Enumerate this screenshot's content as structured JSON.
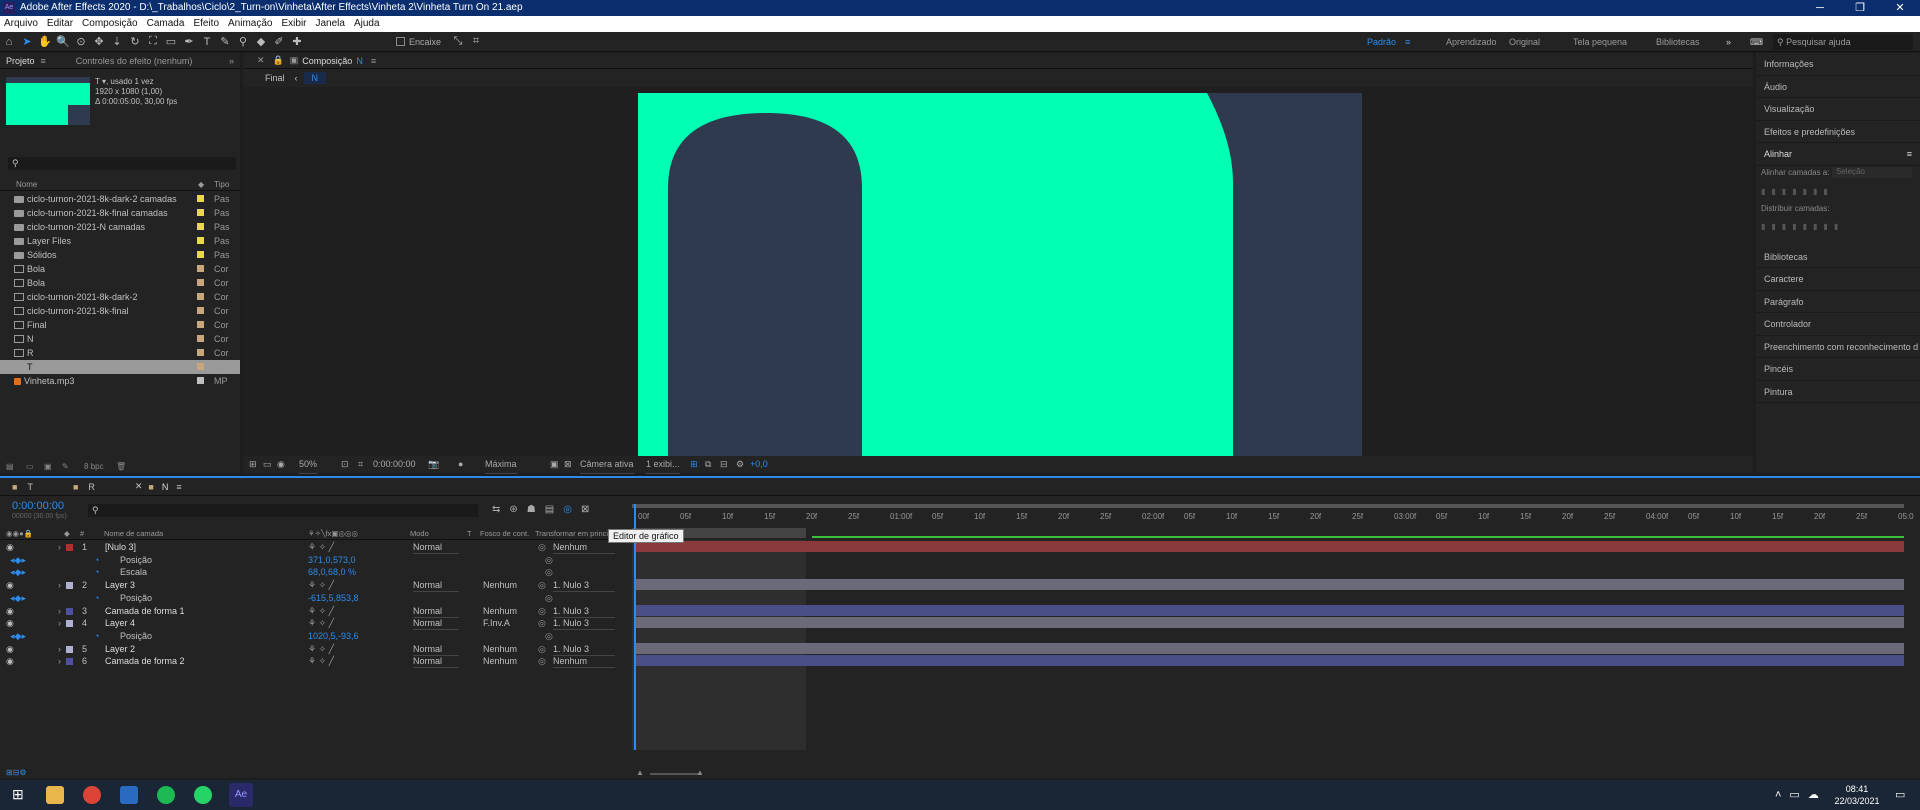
{
  "window": {
    "title": "Adobe After Effects 2020 - D:\\_Trabalhos\\Ciclo\\2_Turn-on\\Vinheta\\After Effects\\Vinheta 2\\Vinheta Turn On 21.aep",
    "app_badge": "Ae"
  },
  "menu": [
    "Arquivo",
    "Editar",
    "Composição",
    "Camada",
    "Efeito",
    "Animação",
    "Exibir",
    "Janela",
    "Ajuda"
  ],
  "toolbar": {
    "snap_label": "Encaixe",
    "search_placeholder": "Pesquisar ajuda"
  },
  "workspaces": [
    "Padrão",
    "Aprendizado",
    "Original",
    "Tela pequena",
    "Bibliotecas"
  ],
  "project": {
    "tab_project": "Projeto",
    "tab_effects": "Controles do efeito (nenhum)",
    "selected_name": "T ▾, usado 1 vez",
    "selected_dims": "1920 x 1080 (1,00)",
    "selected_duration": "Δ 0:00:05:00, 30,00 fps",
    "col_name": "Nome",
    "col_type": "Tipo",
    "bpc": "8 bpc",
    "items": [
      {
        "name": "ciclo-turnon-2021-8k-dark-2 camadas",
        "kind": "folder",
        "color": "#e8d84a",
        "type": "Pas"
      },
      {
        "name": "ciclo-turnon-2021-8k-final camadas",
        "kind": "folder",
        "color": "#e8d84a",
        "type": "Pas"
      },
      {
        "name": "ciclo-turnon-2021-N camadas",
        "kind": "folder",
        "color": "#e8d84a",
        "type": "Pas"
      },
      {
        "name": "Layer Files",
        "kind": "folder",
        "color": "#e8d84a",
        "type": "Pas"
      },
      {
        "name": "Sólidos",
        "kind": "folder",
        "color": "#e8d84a",
        "type": "Pas"
      },
      {
        "name": "Bola",
        "kind": "comp",
        "color": "#c8a87a",
        "type": "Cor"
      },
      {
        "name": "Bola",
        "kind": "comp",
        "color": "#c8a87a",
        "type": "Cor"
      },
      {
        "name": "ciclo-turnon-2021-8k-dark-2",
        "kind": "comp",
        "color": "#c8a87a",
        "type": "Cor"
      },
      {
        "name": "ciclo-turnon-2021-8k-final",
        "kind": "comp",
        "color": "#c8a87a",
        "type": "Cor"
      },
      {
        "name": "Final",
        "kind": "comp",
        "color": "#c8a87a",
        "type": "Cor"
      },
      {
        "name": "N",
        "kind": "comp",
        "color": "#c8a87a",
        "type": "Cor"
      },
      {
        "name": "R",
        "kind": "comp",
        "color": "#c8a87a",
        "type": "Cor"
      },
      {
        "name": "T",
        "kind": "comp",
        "color": "#c8a87a",
        "type": "Cor",
        "selected": true
      },
      {
        "name": "Vinheta.mp3",
        "kind": "audio",
        "color": "#bfbfbf",
        "type": "MP"
      }
    ]
  },
  "composition": {
    "tab_label": "Composição",
    "tab_name": "N",
    "breadcrumb_root": "Final",
    "breadcrumb_current": "N",
    "zoom": "50%",
    "timecode": "0:00:00:00",
    "quality": "Máxima",
    "camera": "Câmera ativa",
    "views": "1 exibi...",
    "exposure": "+0,0",
    "colors": {
      "bg": "#2f3a4f",
      "accent": "#00ffb3"
    }
  },
  "right_panel": [
    "Informações",
    "Áudio",
    "Visualização",
    "Efeitos e predefinições",
    "Alinhar",
    "Bibliotecas",
    "Caractere",
    "Parágrafo",
    "Controlador",
    "Preenchimento com reconhecimento d",
    "Pincéis",
    "Pintura"
  ],
  "align": {
    "align_to_label": "Alinhar camadas a:",
    "align_to_value": "Seleção",
    "distribute_label": "Distribuir camadas:"
  },
  "timeline": {
    "tabs": [
      "T",
      "R",
      "N"
    ],
    "timecode": "0:00:00:00",
    "fps": "00000 (30.00 fps)",
    "tooltip": "Editor de gráfico",
    "headers": {
      "name": "Nome de camada",
      "mode": "Modo",
      "t": "T",
      "matte": "Fosco de cont.",
      "parent": "Transformar em principal"
    },
    "ruler": [
      "00f",
      "05f",
      "10f",
      "15f",
      "20f",
      "25f",
      "01:00f",
      "05f",
      "10f",
      "15f",
      "20f",
      "25f",
      "02:00f",
      "05f",
      "10f",
      "15f",
      "20f",
      "25f",
      "03:00f",
      "05f",
      "10f",
      "15f",
      "20f",
      "25f",
      "04:00f",
      "05f",
      "10f",
      "15f",
      "20f",
      "25f",
      "05:0"
    ],
    "layers": [
      {
        "num": "1",
        "name": "[Nulo 3]",
        "color": "#b03030",
        "mode": "Normal",
        "matte": "",
        "parent": "Nenhum",
        "bar": "#8a3a3a"
      },
      {
        "prop": "Posição",
        "value": "371,0,573,0"
      },
      {
        "prop": "Escala",
        "value": "68,0,68,0 %"
      },
      {
        "num": "2",
        "name": "Layer 3",
        "color": "#b0b0d0",
        "mode": "Normal",
        "matte": "Nenhum",
        "parent": "1. Nulo 3",
        "bar": "#6a6a78"
      },
      {
        "prop": "Posição",
        "value": "-615,5,853,8"
      },
      {
        "num": "3",
        "name": "Camada de forma 1",
        "color": "#5050a0",
        "mode": "Normal",
        "matte": "Nenhum",
        "parent": "1. Nulo 3",
        "bar": "#4a4f88"
      },
      {
        "num": "4",
        "name": "Layer 4",
        "color": "#b0b0d0",
        "mode": "Normal",
        "matte": "F.Inv.A",
        "parent": "1. Nulo 3",
        "bar": "#6a6a78"
      },
      {
        "prop": "Posição",
        "value": "1020,5,-93,6"
      },
      {
        "num": "5",
        "name": "Layer 2",
        "color": "#b0b0d0",
        "mode": "Normal",
        "matte": "Nenhum",
        "parent": "1. Nulo 3",
        "bar": "#6a6a78"
      },
      {
        "num": "6",
        "name": "Camada de forma 2",
        "color": "#5050a0",
        "mode": "Normal",
        "matte": "Nenhum",
        "parent": "Nenhum",
        "bar": "#4a4f88"
      }
    ]
  },
  "taskbar": {
    "time": "08:41",
    "date": "22/03/2021"
  }
}
